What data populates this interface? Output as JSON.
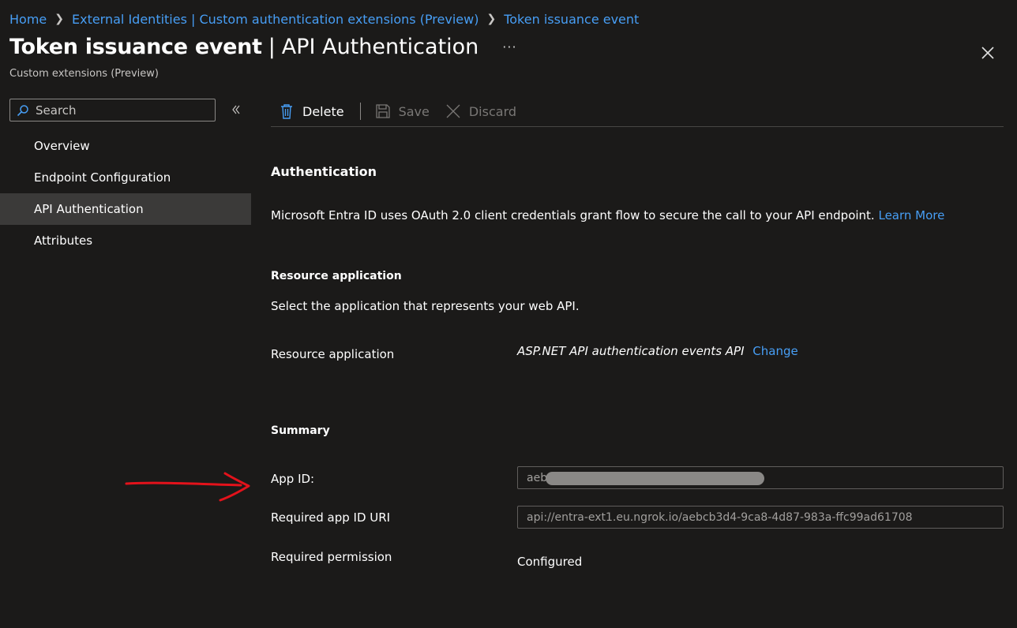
{
  "breadcrumb": {
    "items": [
      "Home",
      "External Identities | Custom authentication extensions (Preview)",
      "Token issuance event"
    ]
  },
  "header": {
    "title": "Token issuance event",
    "separator": "|",
    "section": "API Authentication",
    "more": "···",
    "subtitle": "Custom extensions (Preview)"
  },
  "sidebar": {
    "search_placeholder": "Search",
    "items": [
      {
        "label": "Overview",
        "active": false
      },
      {
        "label": "Endpoint Configuration",
        "active": false
      },
      {
        "label": "API Authentication",
        "active": true
      },
      {
        "label": "Attributes",
        "active": false
      }
    ]
  },
  "toolbar": {
    "delete_label": "Delete",
    "save_label": "Save",
    "discard_label": "Discard"
  },
  "authentication": {
    "heading": "Authentication",
    "description": "Microsoft Entra ID uses OAuth 2.0 client credentials grant flow to secure the call to your API endpoint.",
    "learn_more": "Learn More"
  },
  "resource": {
    "heading": "Resource application",
    "description": "Select the application that represents your web API.",
    "label": "Resource application",
    "value": "ASP.NET API authentication events API",
    "change": "Change"
  },
  "summary": {
    "heading": "Summary",
    "app_id_label": "App ID:",
    "app_id_value": "aeb",
    "uri_label": "Required app ID URI",
    "uri_value": "api://entra-ext1.eu.ngrok.io/aebcb3d4-9ca8-4d87-983a-ffc99ad61708",
    "permission_label": "Required permission",
    "permission_value": "Configured"
  },
  "colors": {
    "background": "#1b1a19",
    "link": "#479ef5",
    "active_nav": "#3b3a39",
    "annotation_arrow": "#e3121b"
  },
  "icons": [
    "chevron-right-icon",
    "close-icon",
    "search-icon",
    "double-chevron-left-icon",
    "trash-icon",
    "save-icon",
    "discard-icon"
  ]
}
